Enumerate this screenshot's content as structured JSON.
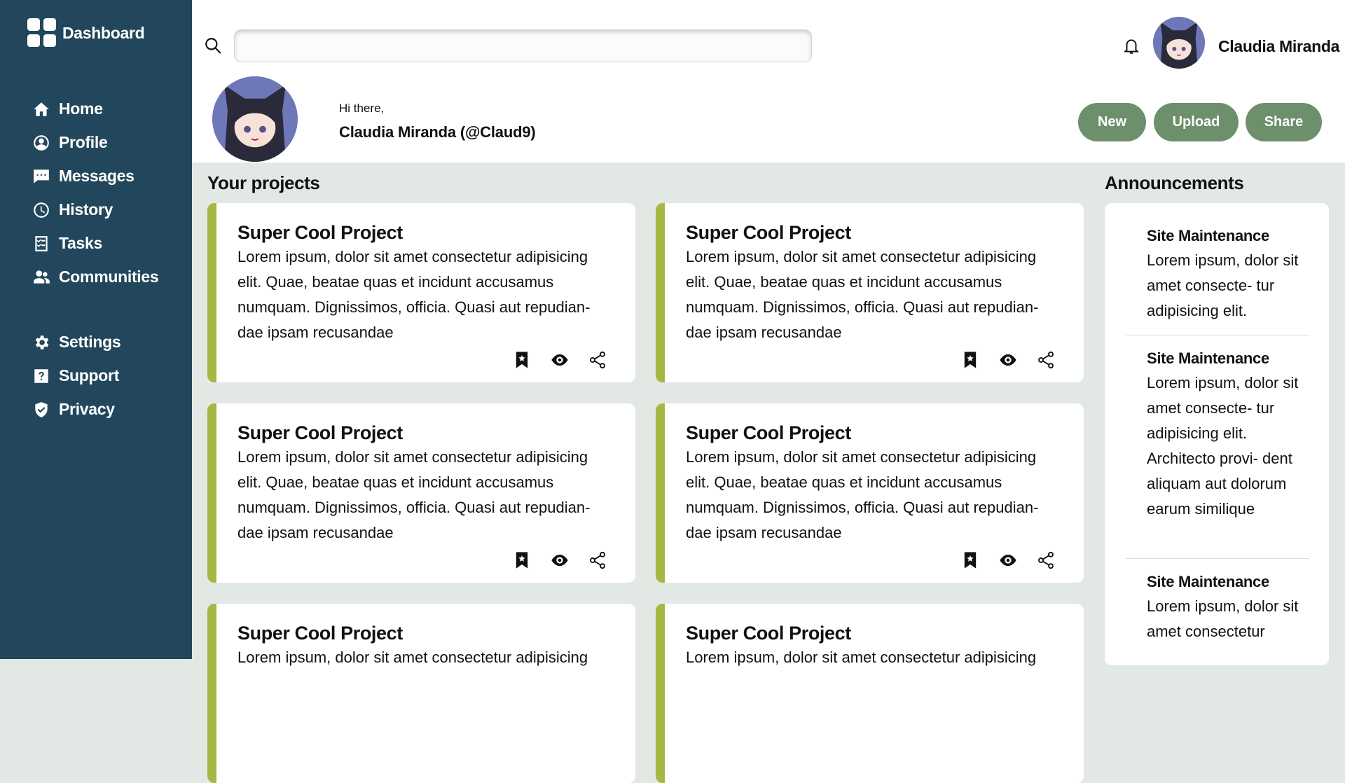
{
  "sidebar": {
    "brand": "Dashboard",
    "nav_items": [
      {
        "label": "Home",
        "icon": "home-icon"
      },
      {
        "label": "Profile",
        "icon": "profile-icon"
      },
      {
        "label": "Messages",
        "icon": "messages-icon"
      },
      {
        "label": "History",
        "icon": "history-icon"
      },
      {
        "label": "Tasks",
        "icon": "tasks-icon"
      },
      {
        "label": "Communities",
        "icon": "communities-icon"
      }
    ],
    "secondary_items": [
      {
        "label": "Settings",
        "icon": "gear-icon"
      },
      {
        "label": "Support",
        "icon": "help-icon"
      },
      {
        "label": "Privacy",
        "icon": "shield-icon"
      }
    ]
  },
  "header": {
    "search": {
      "value": "",
      "placeholder": ""
    },
    "user_name": "Claudia Miranda",
    "greeting": "Hi there,",
    "greeting_name": "Claudia Miranda (@Claud9)",
    "actions": {
      "new": "New",
      "upload": "Upload",
      "share": "Share"
    }
  },
  "projects": {
    "title": "Your projects",
    "cards": [
      {
        "title": "Super Cool Project",
        "body": "Lorem ipsum, dolor sit amet consectetur adipisicing elit. Quae, beatae quas et incidunt accusamus numquam. Dignissimos, officia. Quasi aut repudian- dae ipsam recusandae"
      },
      {
        "title": "Super Cool Project",
        "body": "Lorem ipsum, dolor sit amet consectetur adipisicing elit. Quae, beatae quas et incidunt accusamus numquam. Dignissimos, officia. Quasi aut repudian- dae ipsam recusandae"
      },
      {
        "title": "Super Cool Project",
        "body": "Lorem ipsum, dolor sit amet consectetur adipisicing elit. Quae, beatae quas et incidunt accusamus numquam. Dignissimos, officia. Quasi aut repudian- dae ipsam recusandae"
      },
      {
        "title": "Super Cool Project",
        "body": "Lorem ipsum, dolor sit amet consectetur adipisicing elit. Quae, beatae quas et incidunt accusamus numquam. Dignissimos, officia. Quasi aut repudian- dae ipsam recusandae"
      },
      {
        "title": "Super Cool Project",
        "body": "Lorem ipsum, dolor sit amet consectetur adipisicing"
      },
      {
        "title": "Super Cool Project",
        "body": "Lorem ipsum, dolor sit amet consectetur adipisicing"
      }
    ]
  },
  "announcements": {
    "title": "Announcements",
    "items": [
      {
        "title": "Site Maintenance",
        "body": "Lorem ipsum, dolor sit amet consecte- tur adipisicing elit."
      },
      {
        "title": "Site Maintenance",
        "body": "Lorem ipsum, dolor sit amet consecte- tur adipisicing elit. Architecto provi- dent aliquam aut dolorum earum similique"
      },
      {
        "title": "Site Maintenance",
        "body": "Lorem ipsum, dolor sit amet consectetur"
      }
    ]
  },
  "colors": {
    "sidebar": "#22475c",
    "accent_button": "#6e8f6c",
    "card_border": "#a6b743",
    "background": "#e2e8e4",
    "avatar_bg": "#6e78b8"
  }
}
